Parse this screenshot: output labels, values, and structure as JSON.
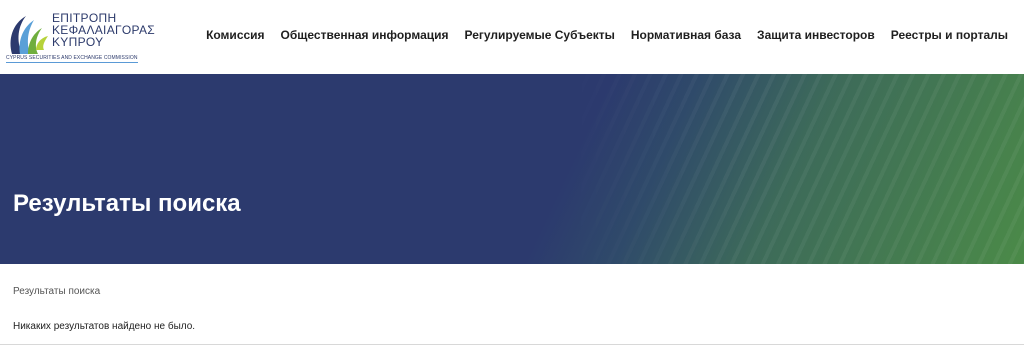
{
  "logo": {
    "line1": "ΕΠΙΤΡΟΠΗ",
    "line2": "ΚΕΦΑΛΑΙΑΓΟΡΑΣ",
    "line3": "ΚΥΠΡΟΥ",
    "subtitle": "CYPRUS SECURITIES AND EXCHANGE COMMISSION",
    "mark": "cysec-logo-icon"
  },
  "nav": {
    "items": [
      {
        "label": "Комиссия"
      },
      {
        "label": "Общественная информация"
      },
      {
        "label": "Регулируемые Субъекты"
      },
      {
        "label": "Нормативная база"
      },
      {
        "label": "Защита инвесторов"
      },
      {
        "label": "Реестры и порталы"
      }
    ]
  },
  "hero": {
    "title": "Результаты поиска"
  },
  "content": {
    "breadcrumb": "Результаты поиска",
    "message": "Никаких результатов найдено не было."
  },
  "colors": {
    "brand_navy": "#2c3a6e",
    "brand_green": "#4b8a48"
  }
}
